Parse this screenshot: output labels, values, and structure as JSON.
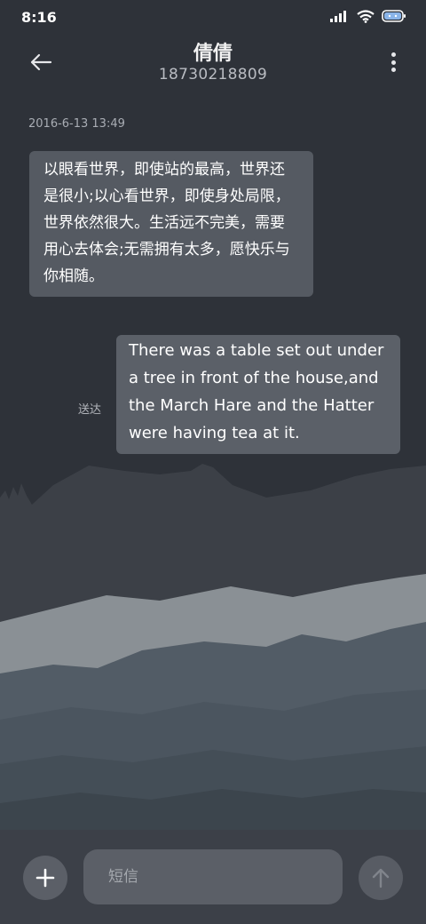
{
  "status_bar": {
    "time": "8:16",
    "icons": [
      "cellular-signal-icon",
      "wifi-icon",
      "battery-icon"
    ]
  },
  "header": {
    "contact_name": "倩倩",
    "contact_number": "18730218809",
    "back_icon": "back-arrow-icon",
    "more_icon": "more-vertical-icon"
  },
  "conversation": {
    "timestamp": "2016-6-13 13:49",
    "messages": [
      {
        "direction": "incoming",
        "text": "以眼看世界，即使站的最高，世界还是很小;以心看世界，即使身处局限，世界依然很大。生活远不完美，需要用心去体会;无需拥有太多，愿快乐与你相随。"
      },
      {
        "direction": "outgoing",
        "text": "There was a table set out under a tree in front of the house,and the March Hare and the Hatter were having tea at it.",
        "status": "送达"
      }
    ]
  },
  "composer": {
    "placeholder": "短信",
    "value": "",
    "add_icon": "plus-icon",
    "send_icon": "send-arrow-up-icon"
  },
  "colors": {
    "background": "#2e3239",
    "bubble_incoming": "#555a62",
    "bubble_outgoing": "#5b6068",
    "bottom_bar": "#3c4048"
  }
}
